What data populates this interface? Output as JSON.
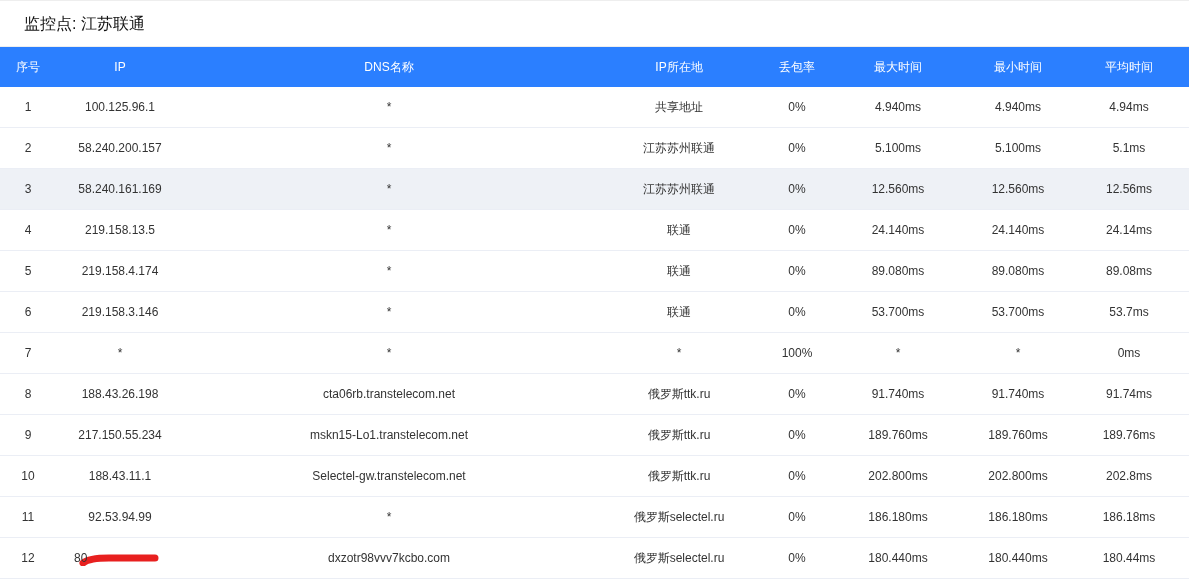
{
  "title": "监控点: 江苏联通",
  "table": {
    "columns": [
      "序号",
      "IP",
      "DNS名称",
      "IP所在地",
      "丢包率",
      "最大时间",
      "最小时间",
      "平均时间"
    ],
    "rows": [
      {
        "cells": [
          "1",
          "100.125.96.1",
          "*",
          "共享地址",
          "0%",
          "4.940ms",
          "4.940ms",
          "4.94ms"
        ],
        "selected": false
      },
      {
        "cells": [
          "2",
          "58.240.200.157",
          "*",
          "江苏苏州联通",
          "0%",
          "5.100ms",
          "5.100ms",
          "5.1ms"
        ],
        "selected": false
      },
      {
        "cells": [
          "3",
          "58.240.161.169",
          "*",
          "江苏苏州联通",
          "0%",
          "12.560ms",
          "12.560ms",
          "12.56ms"
        ],
        "selected": true
      },
      {
        "cells": [
          "4",
          "219.158.13.5",
          "*",
          "联通",
          "0%",
          "24.140ms",
          "24.140ms",
          "24.14ms"
        ],
        "selected": false
      },
      {
        "cells": [
          "5",
          "219.158.4.174",
          "*",
          "联通",
          "0%",
          "89.080ms",
          "89.080ms",
          "89.08ms"
        ],
        "selected": false
      },
      {
        "cells": [
          "6",
          "219.158.3.146",
          "*",
          "联通",
          "0%",
          "53.700ms",
          "53.700ms",
          "53.7ms"
        ],
        "selected": false
      },
      {
        "cells": [
          "7",
          "*",
          "*",
          "*",
          "100%",
          "*",
          "*",
          "0ms"
        ],
        "selected": false
      },
      {
        "cells": [
          "8",
          "188.43.26.198",
          "cta06rb.transtelecom.net",
          "俄罗斯ttk.ru",
          "0%",
          "91.740ms",
          "91.740ms",
          "91.74ms"
        ],
        "selected": false
      },
      {
        "cells": [
          "9",
          "217.150.55.234",
          "mskn15-Lo1.transtelecom.net",
          "俄罗斯ttk.ru",
          "0%",
          "189.760ms",
          "189.760ms",
          "189.76ms"
        ],
        "selected": false
      },
      {
        "cells": [
          "10",
          "188.43.11.1",
          "Selectel-gw.transtelecom.net",
          "俄罗斯ttk.ru",
          "0%",
          "202.800ms",
          "202.800ms",
          "202.8ms"
        ],
        "selected": false
      },
      {
        "cells": [
          "11",
          "92.53.94.99",
          "*",
          "俄罗斯selectel.ru",
          "0%",
          "186.180ms",
          "186.180ms",
          "186.18ms"
        ],
        "selected": false
      },
      {
        "cells": [
          "12",
          "80",
          "dxzotr98vvv7kcbo.com",
          "俄罗斯selectel.ru",
          "0%",
          "180.440ms",
          "180.440ms",
          "180.44ms"
        ],
        "selected": false,
        "redacted": true
      }
    ]
  }
}
